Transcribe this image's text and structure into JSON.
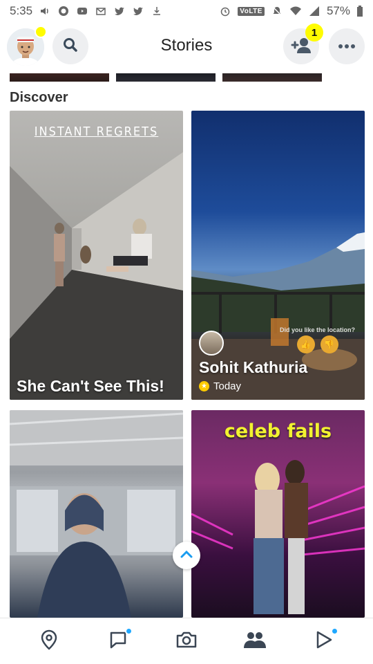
{
  "status_bar": {
    "time": "5:35",
    "network_label": "VoLTE",
    "battery": "57%"
  },
  "header": {
    "title": "Stories",
    "friend_request_count": "1"
  },
  "discover": {
    "section_title": "Discover",
    "cards": [
      {
        "publisher": "INSTANT REGRETS",
        "title": "She Can't See This!"
      },
      {
        "user_name": "Sohit Kathuria",
        "time": "Today",
        "poll_question": "Did you like the location?"
      },
      {
        "title": ""
      },
      {
        "title": "celeb fails"
      }
    ]
  },
  "colors": {
    "accent_yellow": "#fffc00",
    "notification_blue": "#1fa8ff"
  },
  "icons": {
    "search": "search-icon",
    "add_friend": "add-friend-icon",
    "more": "more-icon",
    "map": "map-icon",
    "chat": "chat-icon",
    "camera": "camera-icon",
    "friends": "friends-icon",
    "discover": "discover-icon",
    "scroll_up": "chevron-up-icon"
  }
}
